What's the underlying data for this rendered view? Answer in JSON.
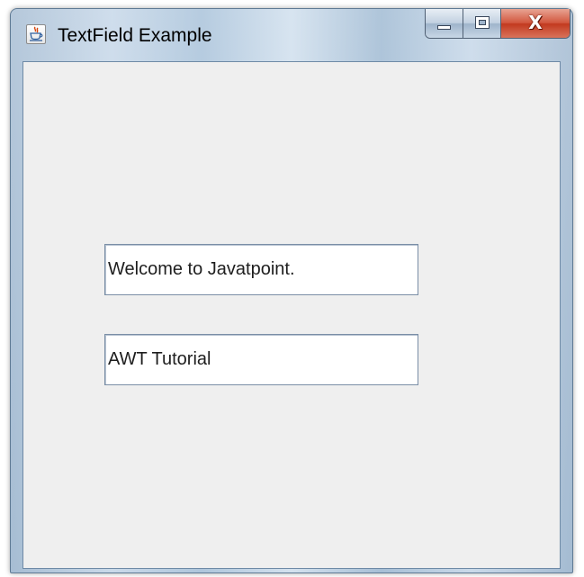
{
  "window": {
    "title": "TextField Example",
    "icon": "java-coffee-cup-icon",
    "caption_buttons": {
      "minimize_icon": "minimize-icon",
      "maximize_icon": "maximize-icon",
      "close_glyph": "X"
    }
  },
  "content": {
    "text_fields": [
      {
        "value": "Welcome to Javatpoint."
      },
      {
        "value": "AWT Tutorial"
      }
    ]
  },
  "colors": {
    "content_background": "#efefef",
    "field_background": "#ffffff",
    "close_button": "#c23a1f"
  }
}
